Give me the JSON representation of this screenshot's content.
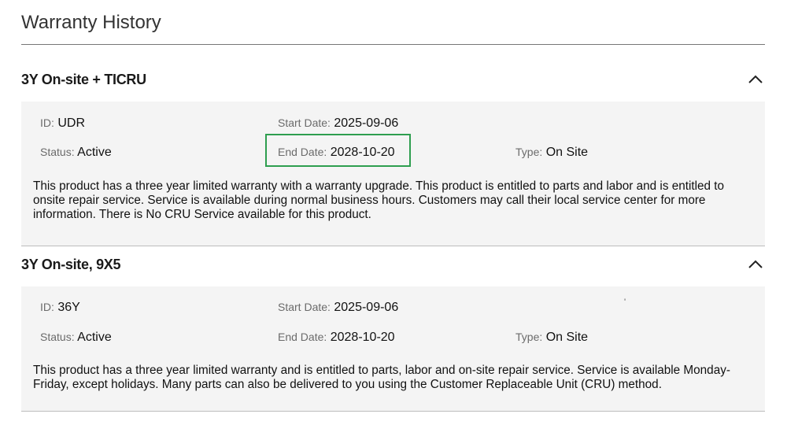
{
  "page": {
    "title": "Warranty History"
  },
  "colors": {
    "panel_bg": "#f4f4f4",
    "highlight": "#2e9e4f",
    "label": "#6b6b6b"
  },
  "labels": {
    "id": "ID",
    "start_date": "Start Date",
    "end_date": "End Date",
    "status": "Status",
    "type": "Type"
  },
  "warranties": [
    {
      "title": "3Y On-site + TICRU",
      "expanded": true,
      "id": "UDR",
      "start_date": "2025-09-06",
      "end_date": "2028-10-20",
      "status": "Active",
      "type": "On Site",
      "description": "This product has a three year limited warranty with a warranty upgrade. This product is entitled to parts and labor and is entitled to onsite repair service. Service is available during normal business hours. Customers may call their local service center for more information. There is No CRU Service available for this product.",
      "chevron_icon": "chevron-up-icon"
    },
    {
      "title": "3Y On-site, 9X5",
      "expanded": true,
      "id": "36Y",
      "start_date": "2025-09-06",
      "end_date": "2028-10-20",
      "status": "Active",
      "type": "On Site",
      "stray_mark": "'",
      "description": "This product has a three year limited warranty and is entitled to parts, labor and on-site repair service. Service is available Monday-Friday, except holidays. Many parts can also be delivered to you using the Customer Replaceable Unit (CRU) method.",
      "chevron_icon": "chevron-up-icon"
    }
  ]
}
